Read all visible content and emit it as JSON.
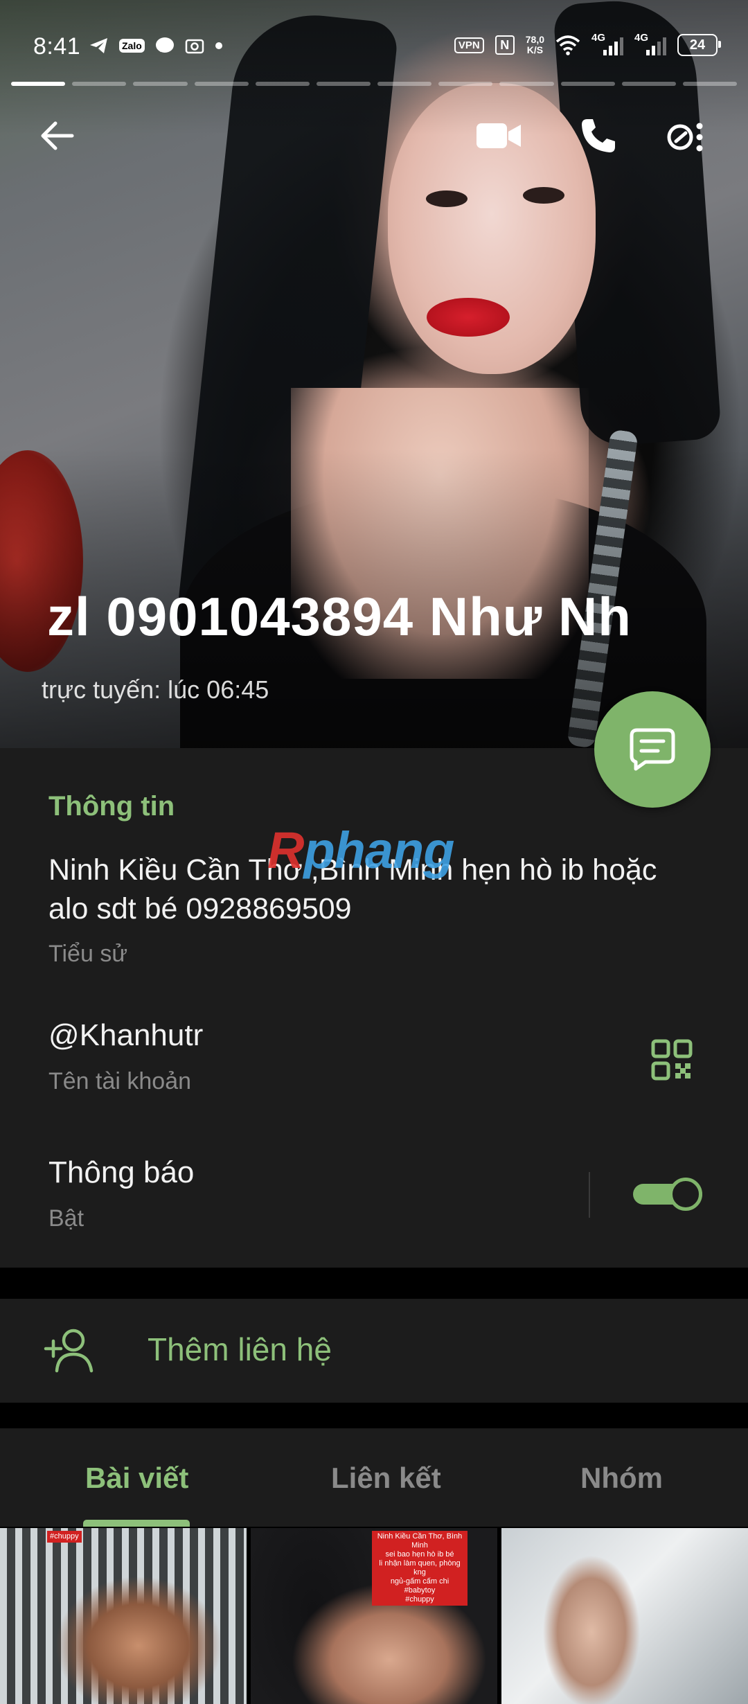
{
  "status_bar": {
    "time": "8:41",
    "left_icons": [
      "telegram-icon",
      "zalo-icon",
      "messenger-icon",
      "screenshot-icon",
      "dot-icon"
    ],
    "zalo_label": "Zalo",
    "vpn_label": "VPN",
    "nfc_label": "N",
    "speed_value": "78,0",
    "speed_unit": "K/S",
    "network1": "4G",
    "network2": "4G",
    "battery": "24"
  },
  "story_segments": 12,
  "header": {
    "name": "zl 0901043894    Như Nh",
    "online_status": "trực tuyến: lúc 06:45"
  },
  "info": {
    "section_title": "Thông tin",
    "bio": "Ninh Kiều Cần Thơ ,Bình Minh hẹn hò ib hoặc alo sdt bé 0928869509",
    "bio_label": "Tiểu sử",
    "username": "@Khanhutr",
    "username_label": "Tên tài khoản",
    "notifications": "Thông báo",
    "notifications_state": "Bật",
    "notifications_on": true
  },
  "add_contact_label": "Thêm liên hệ",
  "tabs": [
    {
      "label": "Bài viết",
      "active": true
    },
    {
      "label": "Liên kết",
      "active": false
    },
    {
      "label": "Nhóm",
      "active": false
    }
  ],
  "watermark": {
    "left": "R",
    "right": "phang"
  },
  "posts": [
    {
      "overlay": "#chuppy"
    },
    {
      "overlay_lines": [
        "Ninh Kiều Cần Thơ, Bình Minh",
        "sei bao hẹn hò ib bé",
        "li nhận làm quen, phòng kng",
        "ngủ-gấm cấm chi",
        "#babytoy",
        "#chuppy"
      ]
    },
    {}
  ],
  "colors": {
    "accent": "#8dc07a",
    "fab": "#7fb46a",
    "card_bg": "#1c1c1c",
    "muted_text": "#8a8a8a"
  }
}
